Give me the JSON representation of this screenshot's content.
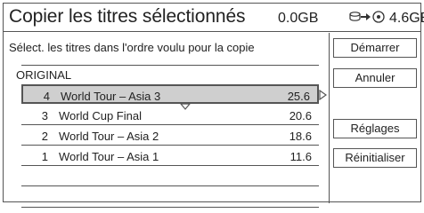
{
  "header": {
    "title": "Copier les titres sélectionnés",
    "used_size": "0.0GB",
    "free_size": "4.6GB",
    "source_icon": "hdd-icon",
    "arrow_icon": "arrow-right-icon",
    "dest_icon": "disc-icon"
  },
  "main": {
    "instruction": "Sélect. les titres dans l'ordre voulu pour la copie",
    "list_header": "ORIGINAL",
    "rows": [
      {
        "num": "4",
        "name": "World Tour – Asia 3",
        "size": "25.6",
        "selected": true
      },
      {
        "num": "3",
        "name": "World Cup Final",
        "size": "20.6",
        "selected": false
      },
      {
        "num": "2",
        "name": "World Tour – Asia 2",
        "size": "18.6",
        "selected": false
      },
      {
        "num": "1",
        "name": "World Tour – Asia 1",
        "size": "11.6",
        "selected": false
      }
    ]
  },
  "buttons": {
    "start": "Démarrer",
    "cancel": "Annuler",
    "settings": "Réglages",
    "reset": "Réinitialiser"
  },
  "colors": {
    "border": "#555555",
    "selected_row": "#cfcfcf"
  }
}
